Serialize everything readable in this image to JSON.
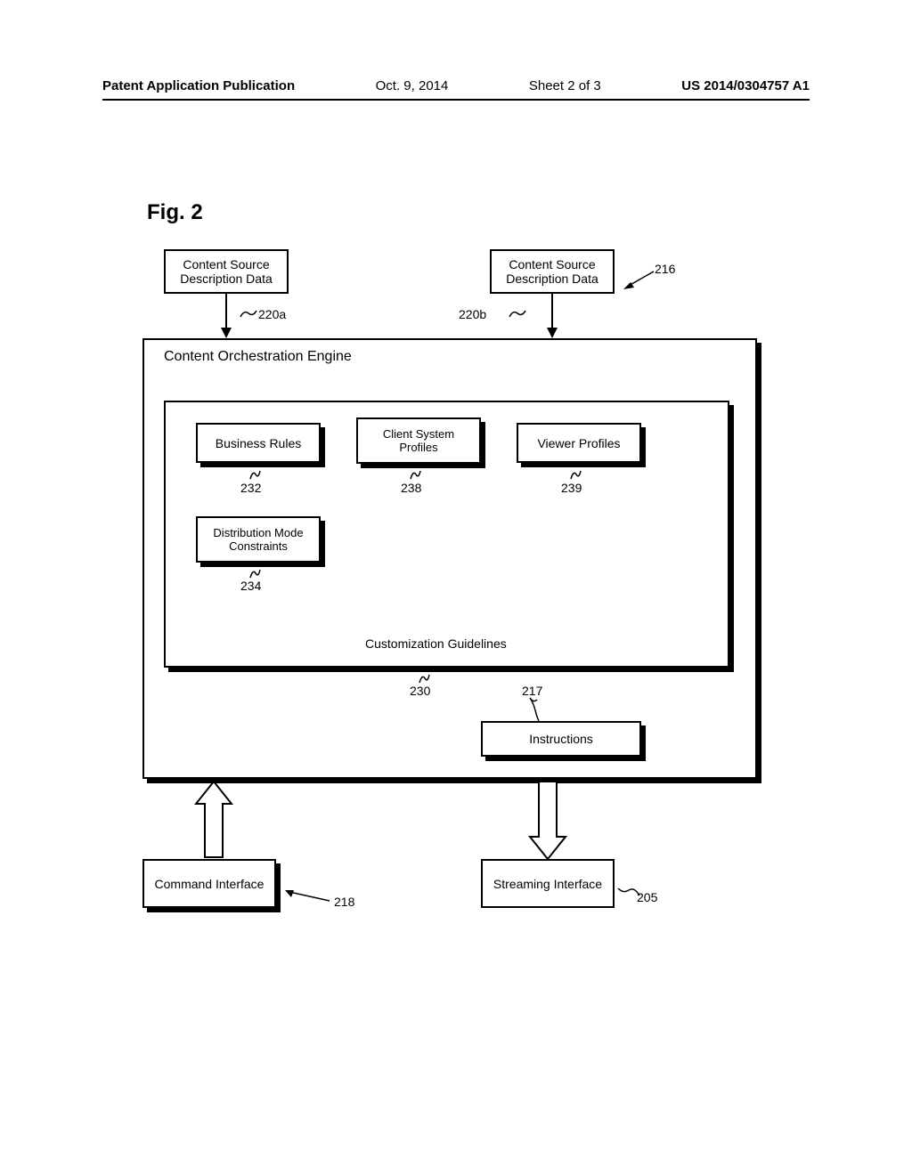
{
  "header": {
    "pub_label": "Patent Application Publication",
    "date": "Oct. 9, 2014",
    "sheet": "Sheet 2 of 3",
    "pub_no": "US 2014/0304757 A1"
  },
  "figure_label": "Fig. 2",
  "engine": {
    "title": "Content Orchestration Engine",
    "customization": "Customization Guidelines",
    "br": "Business Rules",
    "csp": "Client System Profiles",
    "vp": "Viewer Profiles",
    "dmc": "Distribution Mode Constraints",
    "instructions": "Instructions"
  },
  "content_source": "Content Source Description Data",
  "cmd_iface": "Command Interface",
  "stream_iface": "Streaming Interface",
  "refs": {
    "r216": "216",
    "r220a": "220a",
    "r220b": "220b",
    "r232": "232",
    "r238": "238",
    "r239": "239",
    "r234": "234",
    "r230": "230",
    "r217": "217",
    "r218": "218",
    "r205": "205"
  }
}
